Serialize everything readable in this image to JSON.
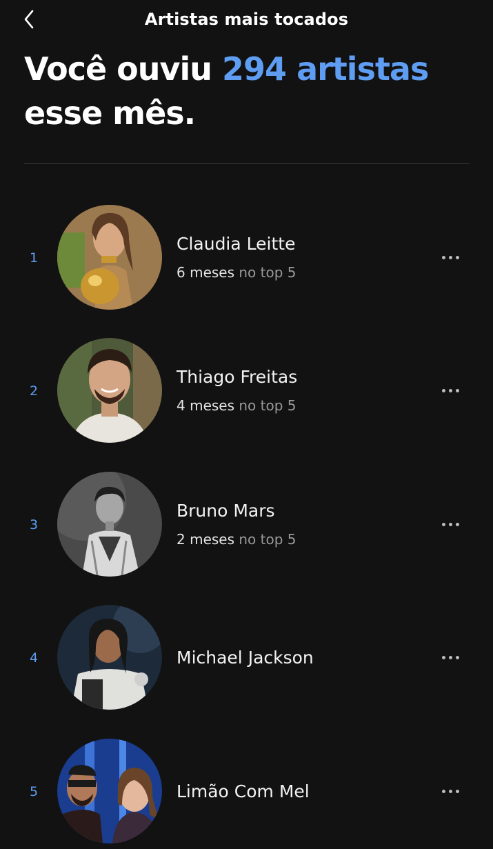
{
  "header": {
    "title": "Artistas mais tocados"
  },
  "headline": {
    "prefix": "Você ouviu",
    "highlight": "294 artistas",
    "suffix": "esse mês."
  },
  "artists": [
    {
      "rank": "1",
      "name": "Claudia Leitte",
      "months": "6 meses",
      "months_suffix": "no top 5"
    },
    {
      "rank": "2",
      "name": "Thiago Freitas",
      "months": "4 meses",
      "months_suffix": "no top 5"
    },
    {
      "rank": "3",
      "name": "Bruno Mars",
      "months": "2 meses",
      "months_suffix": "no top 5"
    },
    {
      "rank": "4",
      "name": "Michael Jackson"
    },
    {
      "rank": "5",
      "name": "Limão Com Mel"
    }
  ],
  "colors": {
    "background": "#121212",
    "accent": "#5e9df2"
  },
  "icons": {
    "back": "chevron-left-icon",
    "more": "more-options-icon"
  }
}
